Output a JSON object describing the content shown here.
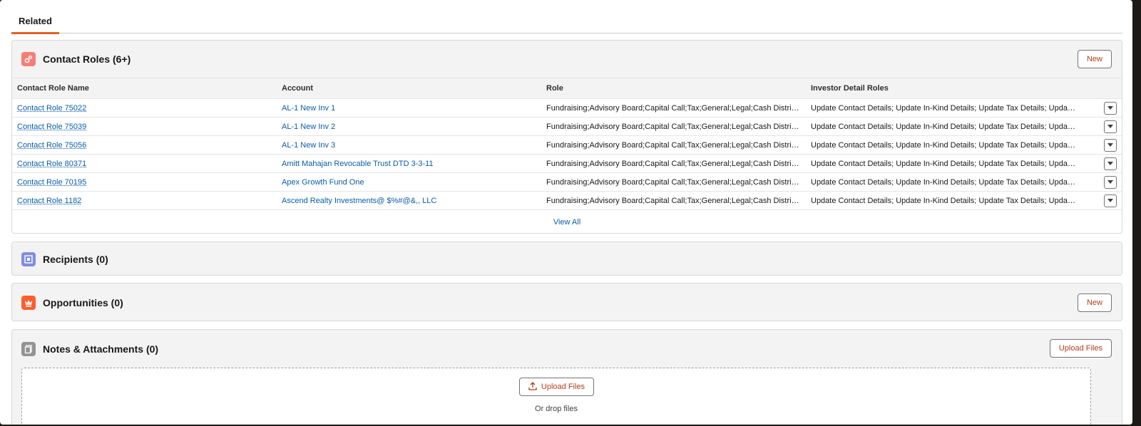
{
  "tabs": [
    {
      "label": "Related",
      "active": true
    }
  ],
  "contact_roles": {
    "title": "Contact Roles (6+)",
    "new_label": "New",
    "columns": [
      "Contact Role Name",
      "Account",
      "Role",
      "Investor Detail Roles"
    ],
    "rows": [
      {
        "name": "Contact Role 75022",
        "account": "AL-1 New Inv 1",
        "role": "Fundraising;Advisory Board;Capital Call;Tax;General;Legal;Cash Distributio...",
        "detail": "Update Contact Details; Update In-Kind Details; Update Tax Details; Updat..."
      },
      {
        "name": "Contact Role 75039",
        "account": "AL-1 New Inv 2",
        "role": "Fundraising;Advisory Board;Capital Call;Tax;General;Legal;Cash Distributio...",
        "detail": "Update Contact Details; Update In-Kind Details; Update Tax Details; Updat..."
      },
      {
        "name": "Contact Role 75056",
        "account": "AL-1 New Inv 3",
        "role": "Fundraising;Advisory Board;Capital Call;Tax;General;Legal;Cash Distributio...",
        "detail": "Update Contact Details; Update In-Kind Details; Update Tax Details; Updat..."
      },
      {
        "name": "Contact Role 80371",
        "account": "Amitt Mahajan Revocable Trust DTD 3-3-11",
        "role": "Fundraising;Advisory Board;Capital Call;Tax;General;Legal;Cash Distributio...",
        "detail": "Update Contact Details; Update In-Kind Details; Update Tax Details; Updat..."
      },
      {
        "name": "Contact Role 70195",
        "account": "Apex Growth Fund One",
        "role": "Fundraising;Advisory Board;Capital Call;Tax;General;Legal;Cash Distributio...",
        "detail": "Update Contact Details; Update In-Kind Details; Update Tax Details; Updat..."
      },
      {
        "name": "Contact Role 1182",
        "account": "Ascend Realty Investments@ $%#@&,, LLC",
        "role": "Fundraising;Advisory Board;Capital Call;Tax;General;Legal;Cash Distributio...",
        "detail": "Update Contact Details; Update In-Kind Details; Update Tax Details; Updat..."
      }
    ],
    "view_all": "View All"
  },
  "recipients": {
    "title": "Recipients (0)"
  },
  "opportunities": {
    "title": "Opportunities (0)",
    "new_label": "New"
  },
  "notes": {
    "title": "Notes & Attachments (0)",
    "upload_label": "Upload Files",
    "drop_button_label": "Upload Files",
    "drop_text": "Or drop files"
  },
  "colors": {
    "accent": "#e4611f",
    "contact_roles_icon": "#f77e75",
    "recipients_icon": "#7f8de1",
    "opportunities_icon": "#ff5d2d",
    "notes_icon": "#939393",
    "link": "#0b5cab"
  },
  "icons": {
    "contact_roles": "gears-icon",
    "recipients": "square-target-icon",
    "opportunities": "crown-icon",
    "notes": "document-icon",
    "row_menu": "chevron-down-icon",
    "upload": "upload-icon"
  }
}
